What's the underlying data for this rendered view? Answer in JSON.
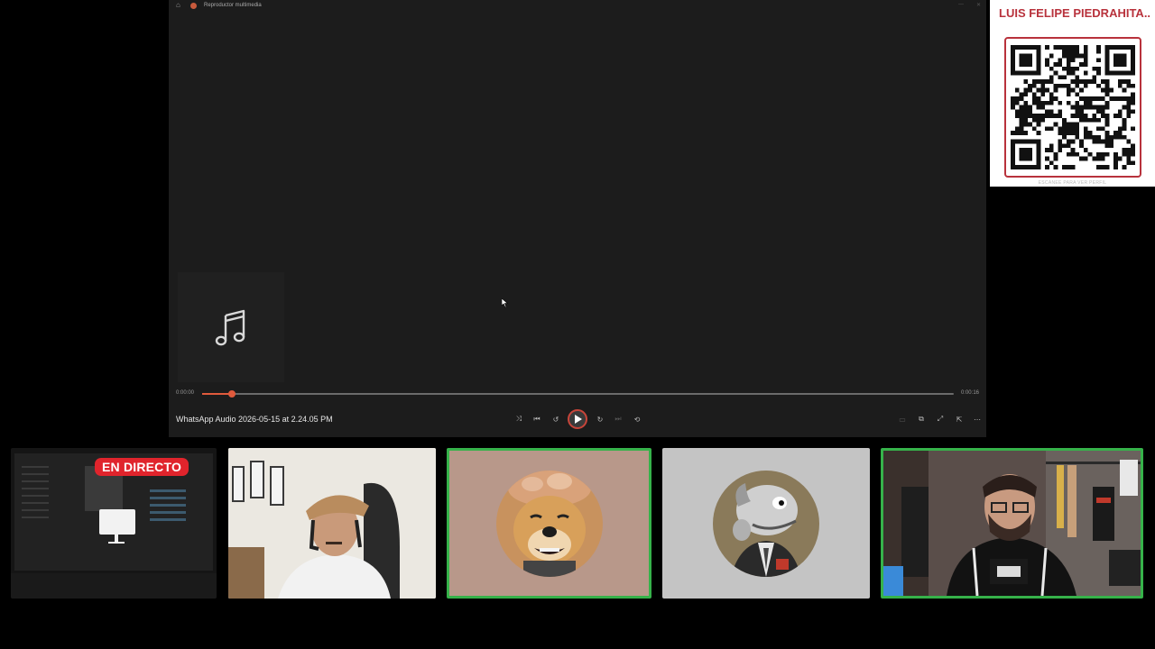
{
  "player": {
    "window_title": "Reproductor multimedia",
    "track_name": "WhatsApp Audio 2026-05-15 at 2.24.05 PM",
    "time_elapsed": "0:00:00",
    "time_total": "0:00:16",
    "progress_fraction": 0.04,
    "music_note_icon": "music-note-icon"
  },
  "profile": {
    "name": "LUIS FELIPE PIEDRAHITA...",
    "qr_caption": "ESCANEE PARA VER PERFIL",
    "accent_color": "#b8323c"
  },
  "participants": [
    {
      "badge": "EN DIRECTO",
      "kind": "screen-share",
      "speaking": false
    },
    {
      "kind": "camera",
      "speaking": false
    },
    {
      "kind": "avatar",
      "speaking": true
    },
    {
      "kind": "avatar",
      "speaking": false
    },
    {
      "kind": "camera",
      "speaking": true
    }
  ],
  "colors": {
    "speaking_border": "#36b24a",
    "live_badge": "#e0242c",
    "player_bg": "#1c1c1c",
    "progress": "#e05a3c"
  }
}
